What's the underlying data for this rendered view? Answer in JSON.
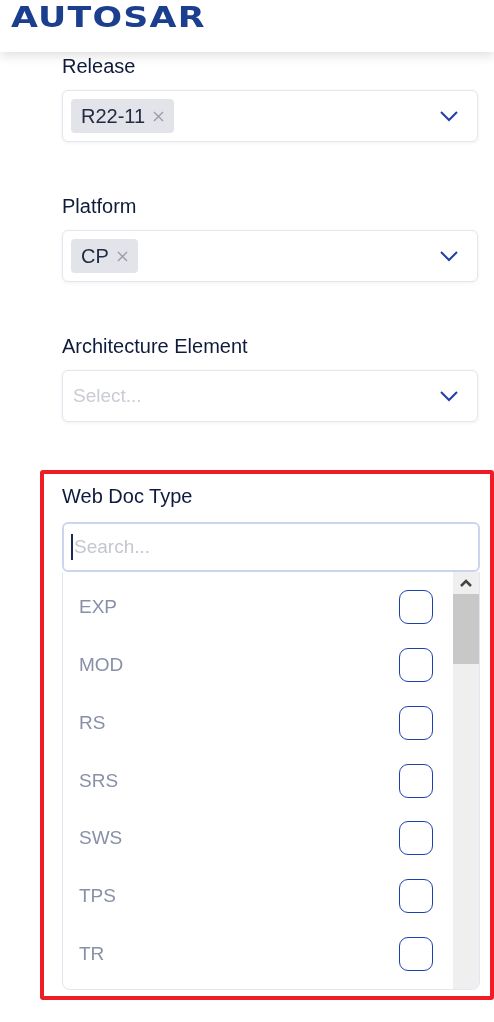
{
  "header": {
    "logo": "AUTOSAR"
  },
  "filters": [
    {
      "label": "Release",
      "kind": "select",
      "tags": [
        "R22-11"
      ]
    },
    {
      "label": "Platform",
      "kind": "select",
      "tags": [
        "CP"
      ]
    },
    {
      "label": "Architecture Element",
      "kind": "select",
      "placeholder": "Select..."
    }
  ],
  "web_doc_type": {
    "label": "Web Doc Type",
    "highlighted": true,
    "search": {
      "placeholder": "Search...",
      "focused": true
    },
    "options": [
      {
        "label": "EXP",
        "checked": false
      },
      {
        "label": "MOD",
        "checked": false
      },
      {
        "label": "RS",
        "checked": false
      },
      {
        "label": "SRS",
        "checked": false
      },
      {
        "label": "SWS",
        "checked": false
      },
      {
        "label": "TPS",
        "checked": false
      },
      {
        "label": "TR",
        "checked": false
      }
    ]
  }
}
